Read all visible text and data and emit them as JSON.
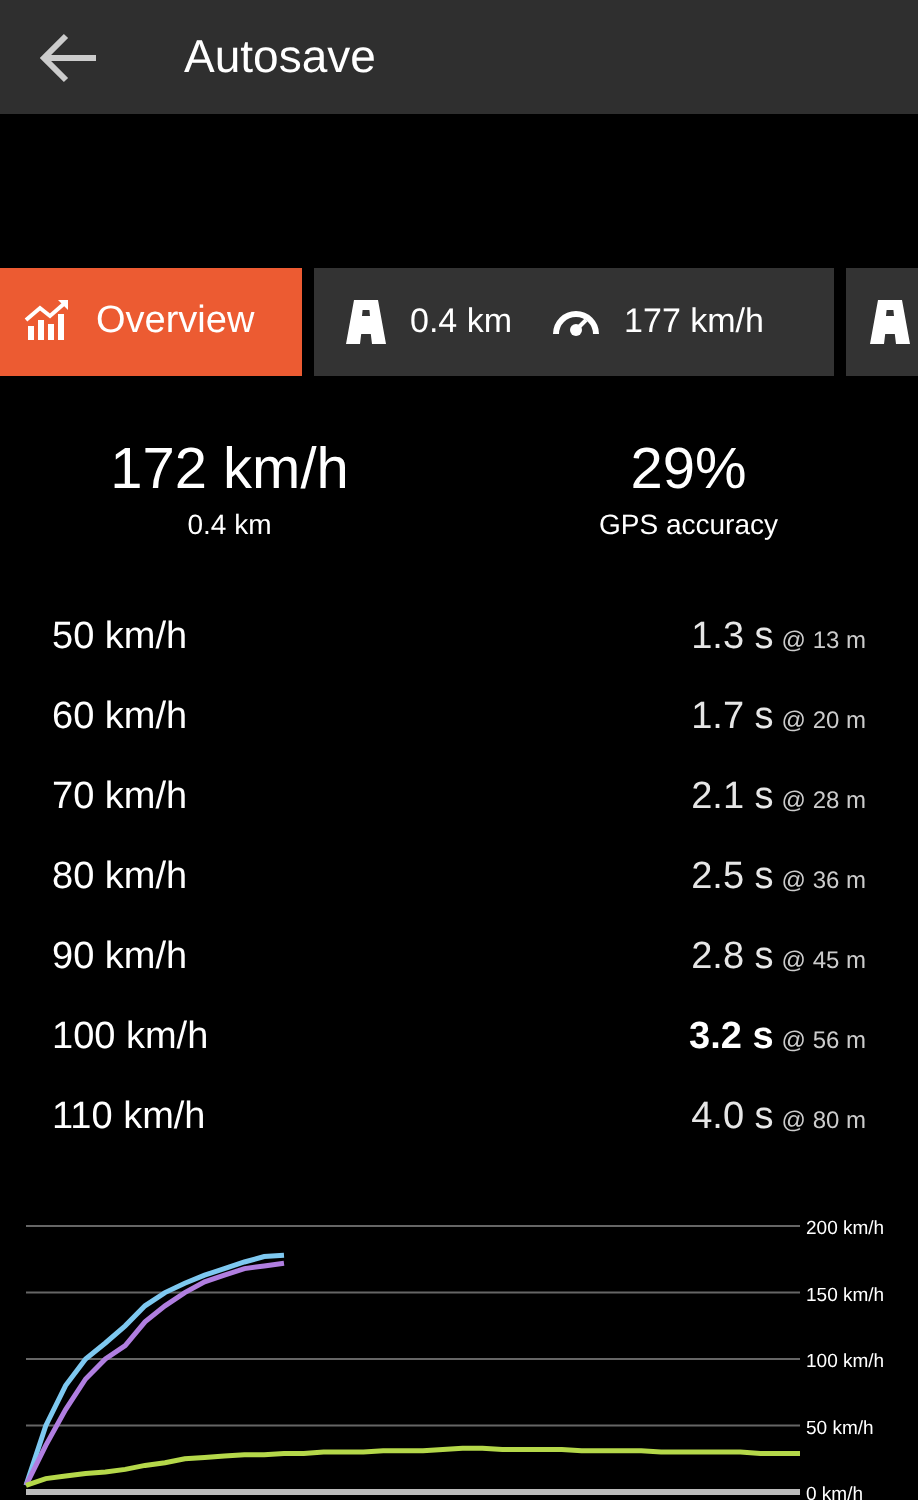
{
  "header": {
    "title": "Autosave"
  },
  "tabs": [
    {
      "kind": "overview",
      "label": "Overview",
      "selected": true
    },
    {
      "kind": "run",
      "distance": "0.4 km",
      "speed": "177 km/h",
      "selected": false
    },
    {
      "kind": "run",
      "selected": false
    }
  ],
  "summary": [
    {
      "value": "172 km/h",
      "caption": "0.4 km"
    },
    {
      "value": "29%",
      "caption": "GPS accuracy"
    }
  ],
  "splits": [
    {
      "speed": "50 km/h",
      "time": "1.3 s",
      "distance": "@ 13 m",
      "highlighted": false
    },
    {
      "speed": "60 km/h",
      "time": "1.7 s",
      "distance": "@ 20 m",
      "highlighted": false
    },
    {
      "speed": "70 km/h",
      "time": "2.1 s",
      "distance": "@ 28 m",
      "highlighted": false
    },
    {
      "speed": "80 km/h",
      "time": "2.5 s",
      "distance": "@ 36 m",
      "highlighted": false
    },
    {
      "speed": "90 km/h",
      "time": "2.8 s",
      "distance": "@ 45 m",
      "highlighted": false
    },
    {
      "speed": "100 km/h",
      "time": "3.2 s",
      "distance": "@ 56 m",
      "highlighted": true
    },
    {
      "speed": "110 km/h",
      "time": "4.0 s",
      "distance": "@ 80 m",
      "highlighted": false
    }
  ],
  "chart_data": {
    "type": "line",
    "grid": true,
    "ylim": [
      0,
      200
    ],
    "yticks": [
      {
        "value": 0,
        "label": "0 km/h"
      },
      {
        "value": 50,
        "label": "50 km/h"
      },
      {
        "value": 100,
        "label": "100 km/h"
      },
      {
        "value": 150,
        "label": "150 km/h"
      },
      {
        "value": 200,
        "label": "200 km/h"
      }
    ],
    "series": [
      {
        "color": "#7ec8f0",
        "values": [
          5,
          50,
          80,
          100,
          112,
          125,
          140,
          150,
          157,
          163,
          168,
          173,
          177,
          178,
          null,
          null,
          null,
          null,
          null,
          null,
          null,
          null,
          null,
          null,
          null,
          null,
          null,
          null,
          null,
          null,
          null,
          null,
          null,
          null,
          null,
          null,
          null,
          null,
          null,
          null
        ]
      },
      {
        "color": "#b07ee0",
        "values": [
          5,
          35,
          62,
          85,
          100,
          110,
          128,
          140,
          150,
          158,
          163,
          168,
          170,
          172,
          null,
          null,
          null,
          null,
          null,
          null,
          null,
          null,
          null,
          null,
          null,
          null,
          null,
          null,
          null,
          null,
          null,
          null,
          null,
          null,
          null,
          null,
          null,
          null,
          null,
          null
        ]
      },
      {
        "color": "#b5d84a",
        "values": [
          5,
          10,
          12,
          14,
          15,
          17,
          20,
          22,
          25,
          26,
          27,
          28,
          28,
          29,
          29,
          30,
          30,
          30,
          31,
          31,
          31,
          32,
          33,
          33,
          32,
          32,
          32,
          32,
          31,
          31,
          31,
          31,
          30,
          30,
          30,
          30,
          30,
          29,
          29,
          29
        ]
      }
    ]
  }
}
